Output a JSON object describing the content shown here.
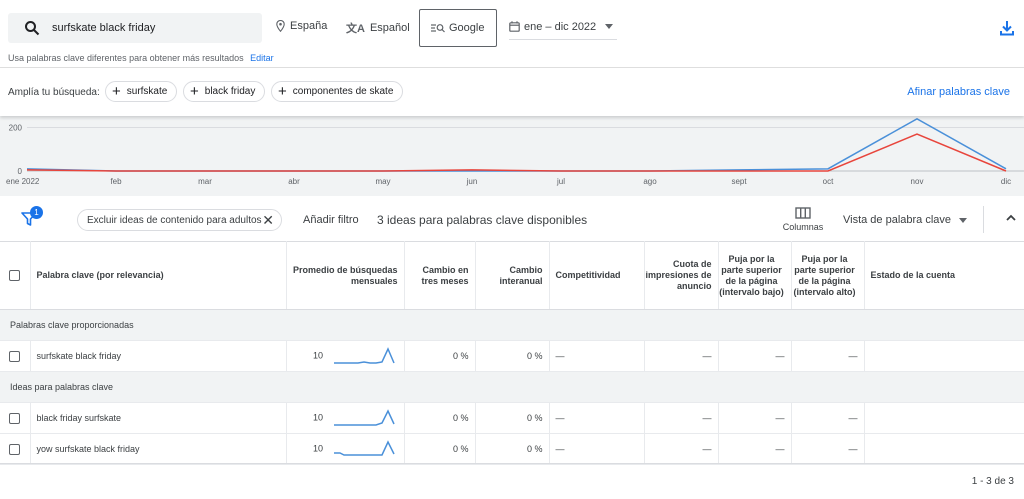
{
  "search": {
    "query": "surfskate black friday"
  },
  "filters": {
    "location": "España",
    "language": "Español",
    "network": "Google",
    "date_range": "ene – dic 2022"
  },
  "hint": {
    "text": "Usa palabras clave diferentes para obtener más resultados",
    "edit_label": "Editar"
  },
  "refine": {
    "label": "Amplía tu búsqueda:",
    "chips": [
      "surfskate",
      "black friday",
      "componentes de skate"
    ],
    "refine_link": "Afinar palabras clave"
  },
  "chart_data": {
    "type": "line",
    "x": [
      "ene 2022",
      "feb",
      "mar",
      "abr",
      "may",
      "jun",
      "jul",
      "ago",
      "sept",
      "oct",
      "nov",
      "dic"
    ],
    "y_ticks": [
      "200",
      "0"
    ],
    "ylim": [
      0,
      230
    ],
    "series": [
      {
        "color": "#4a90d9",
        "values": [
          10,
          0,
          0,
          0,
          0,
          0,
          0,
          0,
          5,
          10,
          260,
          10
        ]
      },
      {
        "color": "#e8453c",
        "values": [
          5,
          0,
          0,
          0,
          0,
          5,
          0,
          0,
          0,
          0,
          170,
          0
        ]
      }
    ]
  },
  "toolbar": {
    "filter_badge": "1",
    "exclude_chip": "Excluir ideas de contenido para adultos",
    "add_filter": "Añadir filtro",
    "ideas_count": "3 ideas para palabras clave disponibles",
    "columns_label": "Columnas",
    "view_label": "Vista de palabra clave"
  },
  "table": {
    "headers": {
      "keyword": "Palabra clave (por relevancia)",
      "avg_searches": "Promedio de búsquedas mensuales",
      "three_month": "Cambio en tres meses",
      "yoy": "Cambio interanual",
      "competition": "Competitividad",
      "impr_share": "Cuota de impresiones de anuncio",
      "bid_low": "Puja por la parte superior de la página (intervalo bajo)",
      "bid_high": "Puja por la parte superior de la página (intervalo alto)",
      "account_status": "Estado de la cuenta"
    },
    "section_provided": "Palabras clave proporcionadas",
    "section_ideas": "Ideas para palabras clave",
    "provided_rows": [
      {
        "keyword": "surfskate black friday",
        "avg": "10",
        "three_month": "0 %",
        "yoy": "0 %",
        "competition": "—",
        "impr": "—",
        "bid_low": "—",
        "bid_high": "—"
      }
    ],
    "idea_rows": [
      {
        "keyword": "black friday surfskate",
        "avg": "10",
        "three_month": "0 %",
        "yoy": "0 %",
        "competition": "—",
        "impr": "—",
        "bid_low": "—",
        "bid_high": "—"
      },
      {
        "keyword": "yow surfskate black friday",
        "avg": "10",
        "three_month": "0 %",
        "yoy": "0 %",
        "competition": "—",
        "impr": "—",
        "bid_low": "—",
        "bid_high": "—"
      }
    ]
  },
  "pagination": {
    "text": "1 - 3 de 3"
  }
}
